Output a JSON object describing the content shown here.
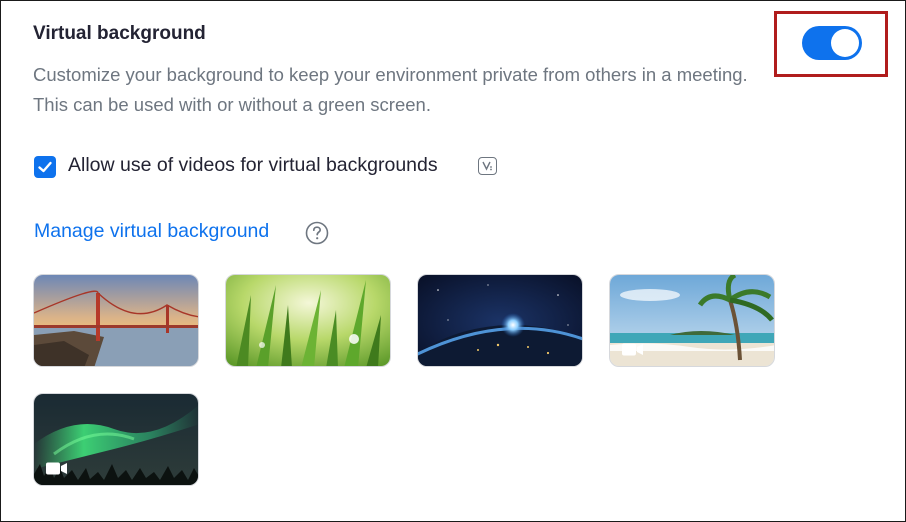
{
  "setting": {
    "title": "Virtual background",
    "description": "Customize your background to keep your environment private from others in a meeting. This can be used with or without a green screen.",
    "enabled": true
  },
  "video_option": {
    "label": "Allow use of videos for virtual backgrounds",
    "checked": true,
    "badge_icon": "v-badge-icon"
  },
  "manage": {
    "link_text": "Manage virtual background",
    "help_icon": "question-circle-icon"
  },
  "backgrounds": [
    {
      "name": "golden-gate-bridge",
      "is_video": false
    },
    {
      "name": "grass",
      "is_video": false
    },
    {
      "name": "earth-from-space",
      "is_video": false
    },
    {
      "name": "beach-palm",
      "is_video": true
    },
    {
      "name": "aurora",
      "is_video": true
    }
  ],
  "colors": {
    "accent": "#0e72ed",
    "highlight_box": "#b01c1c",
    "title_text": "#232333",
    "description_text": "#6e7680"
  }
}
